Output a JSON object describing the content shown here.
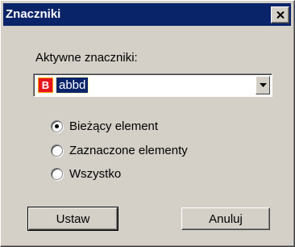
{
  "window": {
    "title": "Znaczniki"
  },
  "tags": {
    "label": "Aktywne znaczniki:",
    "badge": "B",
    "selected": "abbd"
  },
  "scope": {
    "options": [
      "Bieżący element",
      "Zaznaczone elementy",
      "Wszystko"
    ],
    "selected_index": 0
  },
  "buttons": {
    "ok": "Ustaw",
    "cancel": "Anuluj"
  },
  "colors": {
    "titlebar": "#0a246a",
    "badge": "#e8141c",
    "selection": "#0a246a"
  }
}
